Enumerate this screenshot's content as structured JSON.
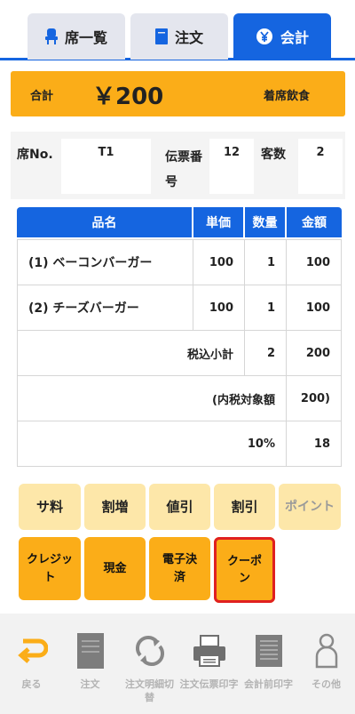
{
  "tabs": [
    {
      "label": "席一覧",
      "icon": "chair-icon",
      "active": false
    },
    {
      "label": "注文",
      "icon": "menu-book-icon",
      "active": false
    },
    {
      "label": "会計",
      "icon": "yen-coin-icon",
      "active": true
    }
  ],
  "total": {
    "label": "合計",
    "amount": "￥200",
    "dining_type": "着席飲食"
  },
  "info": {
    "seat_label": "席No.",
    "seat_value": "T1",
    "slip_label": "伝票番号",
    "slip_value": "12",
    "guests_label": "客数",
    "guests_value": "2"
  },
  "table": {
    "headers": [
      "品名",
      "単価",
      "数量",
      "金額"
    ],
    "items": [
      {
        "name": "(1) ベーコンバーガー",
        "price": "100",
        "qty": "1",
        "amount": "100"
      },
      {
        "name": "(2) チーズバーガー",
        "price": "100",
        "qty": "1",
        "amount": "100"
      }
    ],
    "subtotal": {
      "label": "税込小計",
      "qty": "2",
      "amount": "200"
    },
    "taxable": {
      "label": "(内税対象額",
      "amount": "200)"
    },
    "tax": {
      "rate": "10%",
      "amount": "18"
    }
  },
  "actions_row1": [
    "サ料",
    "割増",
    "値引",
    "割引",
    "ポイント"
  ],
  "actions_row2": [
    "クレジット",
    "現金",
    "電子決済",
    "クーポン"
  ],
  "footer": [
    {
      "label": "戻る",
      "icon": "return-arrow-icon"
    },
    {
      "label": "注文",
      "icon": "document-icon"
    },
    {
      "label": "注文明細切替",
      "icon": "refresh-icon"
    },
    {
      "label": "注文伝票印字",
      "icon": "printer-icon"
    },
    {
      "label": "会計前印字",
      "icon": "receipt-icon"
    },
    {
      "label": "その他",
      "icon": "person-icon"
    }
  ],
  "colors": {
    "primary": "#1565e0",
    "accent": "#fbad18",
    "pale": "#fde7a9",
    "highlight": "#e02020"
  }
}
